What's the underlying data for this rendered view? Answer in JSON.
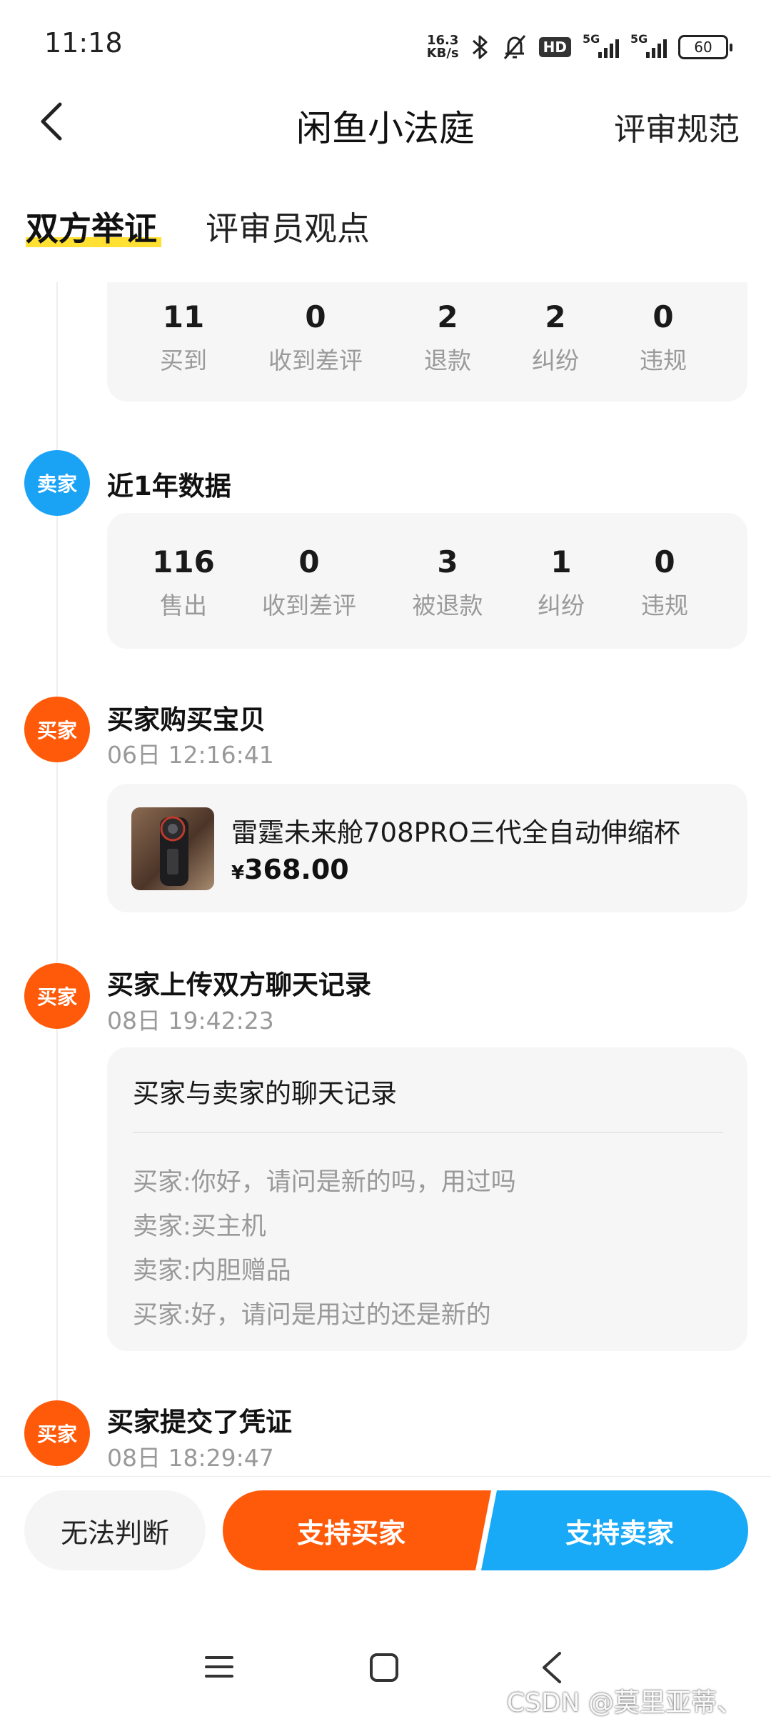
{
  "status_bar": {
    "time": "11:18",
    "net_speed_value": "16.3",
    "net_speed_unit": "KB/s",
    "hd_label": "HD",
    "signal1_label": "5G",
    "signal2_label": "5G",
    "battery": "60"
  },
  "header": {
    "title": "闲鱼小法庭",
    "rules_link": "评审规范"
  },
  "tabs": [
    {
      "label": "双方举证",
      "active": true
    },
    {
      "label": "评审员观点",
      "active": false
    }
  ],
  "buyer_stats": [
    {
      "value": "11",
      "label": "买到"
    },
    {
      "value": "0",
      "label": "收到差评"
    },
    {
      "value": "2",
      "label": "退款"
    },
    {
      "value": "2",
      "label": "纠纷"
    },
    {
      "value": "0",
      "label": "违规"
    }
  ],
  "seller_event": {
    "avatar": "卖家",
    "title": "近1年数据",
    "stats": [
      {
        "value": "116",
        "label": "售出"
      },
      {
        "value": "0",
        "label": "收到差评"
      },
      {
        "value": "3",
        "label": "被退款"
      },
      {
        "value": "1",
        "label": "纠纷"
      },
      {
        "value": "0",
        "label": "违规"
      }
    ]
  },
  "purchase_event": {
    "avatar": "买家",
    "title": "买家购买宝贝",
    "time": "06日 12:16:41",
    "product": {
      "title": "雷霆未来舱708PRO三代全自动伸缩杯",
      "price_symbol": "¥",
      "price": "368.00"
    }
  },
  "chat_event": {
    "avatar": "买家",
    "title": "买家上传双方聊天记录",
    "time": "08日 19:42:23",
    "card_title": "买家与卖家的聊天记录",
    "lines": [
      "买家:你好，请问是新的吗，用过吗",
      "卖家:买主机",
      "卖家:内胆赠品",
      "买家:好，请问是用过的还是新的"
    ]
  },
  "evidence_event": {
    "avatar": "买家",
    "title": "买家提交了凭证",
    "time": "08日 18:29:47"
  },
  "actions": {
    "undecided": "无法判断",
    "support_buyer": "支持买家",
    "support_seller": "支持卖家"
  },
  "watermark": "CSDN @莫里亚蒂、",
  "colors": {
    "buyer": "#ff5a0a",
    "seller": "#1aa3f5",
    "tab_highlight": "#ffe033"
  }
}
